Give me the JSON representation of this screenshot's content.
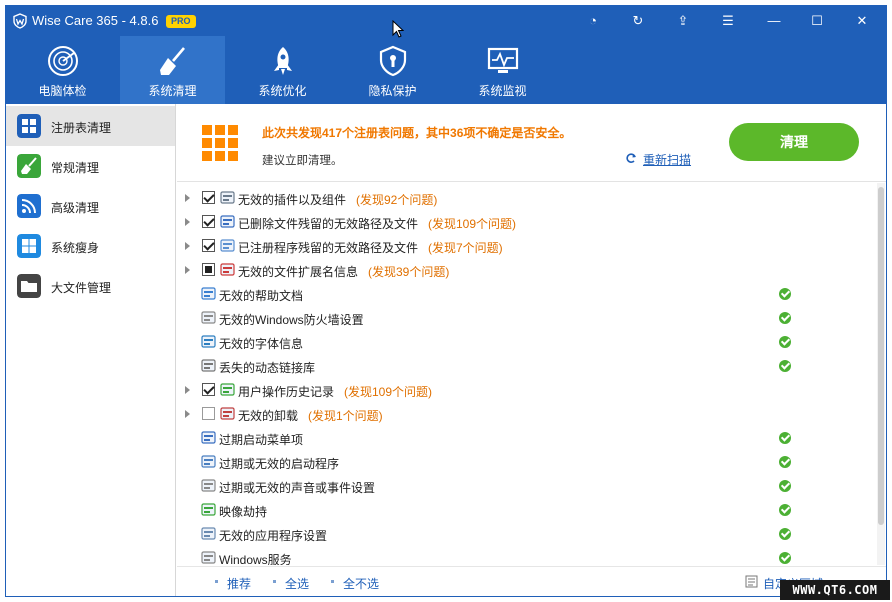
{
  "app": {
    "title": "Wise Care 365 - 4.8.6",
    "badge": "PRO",
    "accent": "#1f5fb8"
  },
  "titlebar_buttons": [
    {
      "name": "history-icon",
      "glyph": "◔"
    },
    {
      "name": "refresh-icon",
      "glyph": "↻"
    },
    {
      "name": "upload-icon",
      "glyph": "⇪"
    },
    {
      "name": "menu-icon",
      "glyph": "☰"
    },
    {
      "name": "minimize-icon",
      "glyph": "—"
    },
    {
      "name": "maximize-icon",
      "glyph": "☐"
    },
    {
      "name": "close-icon",
      "glyph": "✕"
    }
  ],
  "nav": [
    {
      "label": "电脑体检",
      "icon": "radar-icon"
    },
    {
      "label": "系统清理",
      "icon": "broom-icon",
      "active": true
    },
    {
      "label": "系统优化",
      "icon": "rocket-icon"
    },
    {
      "label": "隐私保护",
      "icon": "shield-icon"
    },
    {
      "label": "系统监视",
      "icon": "monitor-icon"
    }
  ],
  "sidebar": [
    {
      "label": "注册表清理",
      "icon": "registry-icon",
      "color": "#1f5fb8",
      "active": true
    },
    {
      "label": "常规清理",
      "icon": "brush-icon",
      "color": "#3aa63a"
    },
    {
      "label": "高级清理",
      "icon": "rss-icon",
      "color": "#1f6fd0"
    },
    {
      "label": "系统瘦身",
      "icon": "windows-icon",
      "color": "#1f8ae0"
    },
    {
      "label": "大文件管理",
      "icon": "folder-icon",
      "color": "#444444"
    }
  ],
  "header": {
    "summary": "此次共发现417个注册表问题，其中36项不确定是否安全。",
    "suggest": "建议立即清理。",
    "rescan": "重新扫描",
    "clean_button": "清理",
    "clean_color": "#5cb82a",
    "summary_color": "#f07800"
  },
  "rows": [
    {
      "label": "无效的插件以及组件",
      "count": "(发现92个问题)",
      "expand": true,
      "check": "checked",
      "icon": "plugin-icon"
    },
    {
      "label": "已删除文件残留的无效路径及文件",
      "count": "(发现109个问题)",
      "expand": true,
      "check": "checked",
      "icon": "file-path-icon"
    },
    {
      "label": "已注册程序残留的无效路径及文件",
      "count": "(发现7个问题)",
      "expand": true,
      "check": "checked",
      "icon": "program-icon"
    },
    {
      "label": "无效的文件扩展名信息",
      "count": "(发现39个问题)",
      "expand": true,
      "check": "partial",
      "icon": "extension-icon"
    },
    {
      "label": "无效的帮助文档",
      "count": "",
      "expand": false,
      "check": "none",
      "icon": "help-doc-icon",
      "ok": true
    },
    {
      "label": "无效的Windows防火墙设置",
      "count": "",
      "expand": false,
      "check": "none",
      "icon": "firewall-icon",
      "ok": true
    },
    {
      "label": "无效的字体信息",
      "count": "",
      "expand": false,
      "check": "none",
      "icon": "font-icon",
      "ok": true
    },
    {
      "label": "丢失的动态链接库",
      "count": "",
      "expand": false,
      "check": "none",
      "icon": "dll-icon",
      "ok": true
    },
    {
      "label": "用户操作历史记录",
      "count": "(发现109个问题)",
      "expand": true,
      "check": "checked",
      "icon": "history-record-icon"
    },
    {
      "label": "无效的卸载",
      "count": "(发现1个问题)",
      "expand": true,
      "check": "empty",
      "icon": "uninstall-icon"
    },
    {
      "label": "过期启动菜单项",
      "count": "",
      "expand": false,
      "check": "none",
      "icon": "start-menu-icon",
      "ok": true
    },
    {
      "label": "过期或无效的启动程序",
      "count": "",
      "expand": false,
      "check": "none",
      "icon": "startup-icon",
      "ok": true
    },
    {
      "label": "过期或无效的声音或事件设置",
      "count": "",
      "expand": false,
      "check": "none",
      "icon": "sound-icon",
      "ok": true
    },
    {
      "label": "映像劫持",
      "count": "",
      "expand": false,
      "check": "none",
      "icon": "bug-icon",
      "ok": true
    },
    {
      "label": "无效的应用程序设置",
      "count": "",
      "expand": false,
      "check": "none",
      "icon": "app-settings-icon",
      "ok": true
    },
    {
      "label": "Windows服务",
      "count": "",
      "expand": false,
      "check": "none",
      "icon": "gear-icon",
      "ok": true
    }
  ],
  "footer": {
    "recommend": "推荐",
    "select_all": "全选",
    "select_none": "全不选",
    "custom_area": "自定义区域"
  },
  "watermark": "WWW.QT6.COM"
}
